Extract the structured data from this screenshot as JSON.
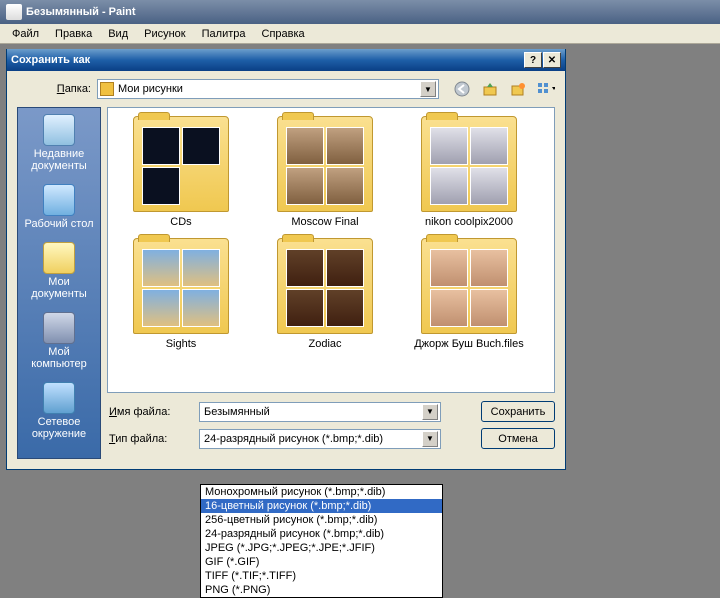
{
  "app": {
    "title": "Безымянный - Paint"
  },
  "menu": [
    "Файл",
    "Правка",
    "Вид",
    "Рисунок",
    "Палитра",
    "Справка"
  ],
  "dialog": {
    "title": "Сохранить как",
    "folder_label": "Папка:",
    "folder_value": "Мои рисунки",
    "sidebar": [
      {
        "label": "Недавние документы",
        "icon": "recent"
      },
      {
        "label": "Рабочий стол",
        "icon": "desktop"
      },
      {
        "label": "Мои документы",
        "icon": "mydocs"
      },
      {
        "label": "Мой компьютер",
        "icon": "mycomp"
      },
      {
        "label": "Сетевое окружение",
        "icon": "network"
      }
    ],
    "folders": [
      {
        "name": "CDs",
        "style": "dark"
      },
      {
        "name": "Moscow Final",
        "style": "dog"
      },
      {
        "name": "nikon coolpix2000",
        "style": "cam"
      },
      {
        "name": "Sights",
        "style": "sky"
      },
      {
        "name": "Zodiac",
        "style": "body"
      },
      {
        "name": "Джорж Буш Buch.files",
        "style": "skin"
      }
    ],
    "filename_label": "Имя файла:",
    "filename_value": "Безымянный",
    "filetype_label": "Тип файла:",
    "filetype_value": "24-разрядный рисунок (*.bmp;*.dib)",
    "save_label": "Сохранить",
    "cancel_label": "Отмена",
    "filetype_options": [
      "Монохромный рисунок (*.bmp;*.dib)",
      "16-цветный рисунок (*.bmp;*.dib)",
      "256-цветный рисунок (*.bmp;*.dib)",
      "24-разрядный рисунок (*.bmp;*.dib)",
      "JPEG (*.JPG;*.JPEG;*.JPE;*.JFIF)",
      "GIF (*.GIF)",
      "TIFF (*.TIF;*.TIFF)",
      "PNG (*.PNG)"
    ],
    "filetype_selected_index": 1
  }
}
